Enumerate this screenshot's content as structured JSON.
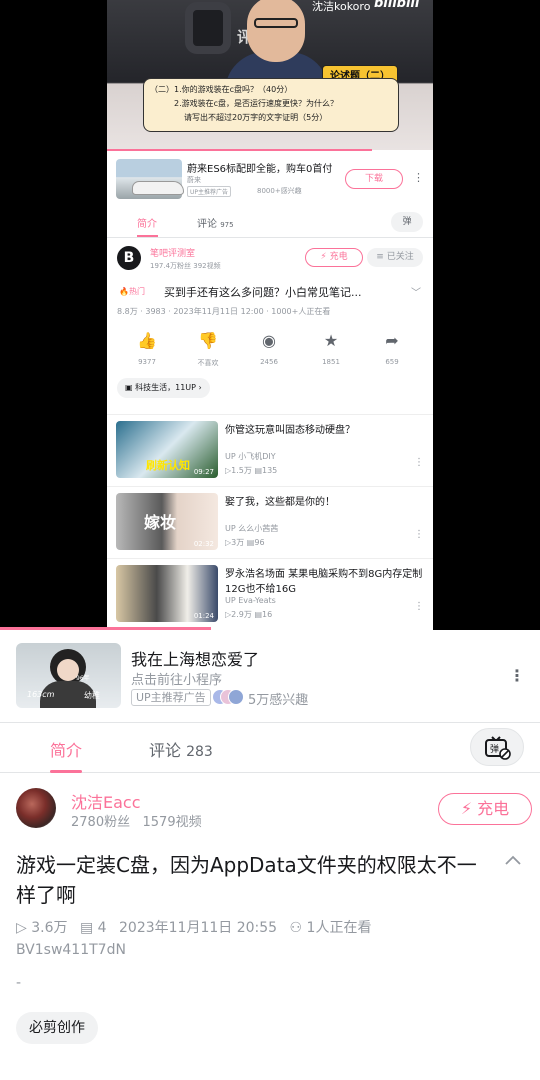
{
  "video_overlay": {
    "watermark_user": "沈洁kokoro",
    "watermark_brand": "bilibili",
    "channel_logo_text": "评测室",
    "question_badge": "论述题（二）",
    "question_line1": "（二）1.你的游戏装在c盘吗？（40分）",
    "question_line2": "2.游戏装在c盘，是否运行速度更快？为什么？",
    "question_line3": "请写出不超过20万字的文字证明（5分）"
  },
  "inner_ad": {
    "title": "蔚来ES6标配即全能，购车0首付",
    "advertiser": "蔚来",
    "tag": "UP主推荐广告",
    "interest": "8000+感兴趣",
    "download_label": "下载"
  },
  "inner_tabs": {
    "intro": "简介",
    "comments": "评论",
    "comments_count": "975",
    "danmaku_label": "弹"
  },
  "inner_uploader": {
    "name": "笔吧评测室",
    "stats": "197.4万粉丝 392视频",
    "charge_label": "充电",
    "follow_label": "已关注",
    "avatar_letter": "B"
  },
  "inner_video": {
    "hot_label": "热门",
    "title": "买到手还有这么多问题？小白常见笔记...",
    "meta": "8.8万 · 3983 · 2023年11月11日 12:00 · 1000+人正在看"
  },
  "inner_actions": [
    {
      "icon": "like-icon",
      "count": "9377"
    },
    {
      "icon": "dislike-icon",
      "count": "不喜欢"
    },
    {
      "icon": "coin-icon",
      "count": "2456"
    },
    {
      "icon": "star-icon",
      "count": "1851"
    },
    {
      "icon": "share-icon",
      "count": "659"
    }
  ],
  "inner_tag": "科技生活，11UP",
  "recommendations": [
    {
      "title": "你管这玩意叫固态移动硬盘？",
      "owner": "小飞机DIY",
      "views": "1.5万",
      "danmaku": "135",
      "duration": "09:27",
      "thumb_text": "刷新认知"
    },
    {
      "title": "娶了我，这些都是你的！",
      "owner": "么么小茜茜",
      "views": "3万",
      "danmaku": "96",
      "duration": "02:32",
      "thumb_text": "嫁妆"
    },
    {
      "title": "罗永浩名场面 某果电脑采购不到8G内存定制12G也不给16G",
      "owner": "Eva-Yeats",
      "views": "2.9万",
      "danmaku": "16",
      "duration": "01:24",
      "thumb_text": ""
    }
  ],
  "colors": {
    "accent": "#fb7299",
    "muted": "#9499a0",
    "text": "#18191c"
  },
  "playback": {
    "progress_fraction": 0.39
  },
  "ad": {
    "title": "我在上海想恋爱了",
    "subtitle": "点击前往小程序",
    "tag": "UP主推荐广告",
    "interest": "5万感兴趣",
    "thumb_label_left": "163cm",
    "thumb_label_right": "幼稚",
    "thumb_label_top": "96年"
  },
  "tabs": {
    "intro": "简介",
    "comments": "评论",
    "comments_count": "283"
  },
  "uploader": {
    "name": "沈洁Eacc",
    "fans": "2780粉丝",
    "videos": "1579视频",
    "charge_label": "充电"
  },
  "video": {
    "title": "游戏一定装C盘，因为AppData文件夹的权限太不一样了啊",
    "views": "3.6万",
    "danmaku": "4",
    "date": "2023年11月11日 20:55",
    "watching": "1人正在看",
    "bvid": "BV1sw411T7dN",
    "desc": "-",
    "tag": "必剪创作"
  }
}
